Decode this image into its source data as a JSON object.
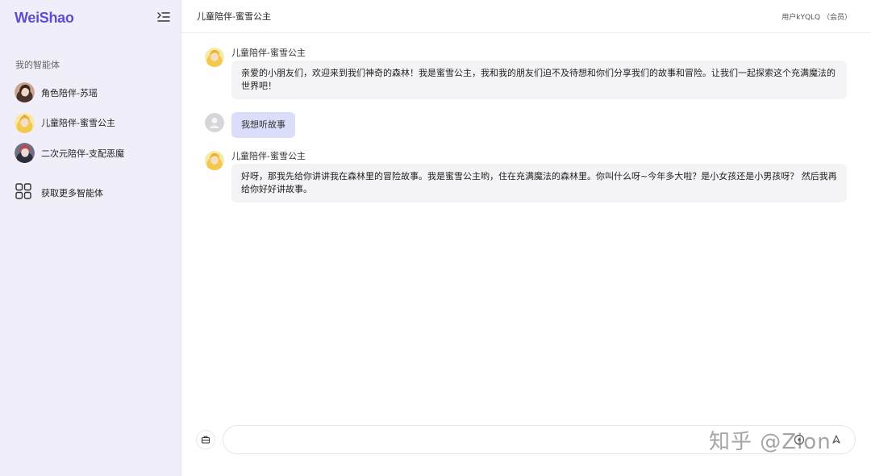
{
  "sidebar": {
    "logo": "WeiShao",
    "section_title": "我的智能体",
    "agents": [
      {
        "label": "角色陪伴-苏瑶",
        "avatar": "woman-portrait"
      },
      {
        "label": "儿童陪伴-蜜雪公主",
        "avatar": "princess-portrait"
      },
      {
        "label": "二次元陪伴-支配恶魔",
        "avatar": "anime-portrait"
      }
    ],
    "more_label": "获取更多智能体"
  },
  "header": {
    "title": "儿童陪伴-蜜雪公主",
    "user": "用户kYQLQ （会员）"
  },
  "messages": [
    {
      "role": "assistant",
      "sender": "儿童陪伴-蜜雪公主",
      "text": "亲爱的小朋友们，欢迎来到我们神奇的森林！我是蜜雪公主，我和我的朋友们迫不及待想和你们分享我们的故事和冒险。让我们一起探索这个充满魔法的世界吧！"
    },
    {
      "role": "user",
      "text": "我想听故事"
    },
    {
      "role": "assistant",
      "sender": "儿童陪伴-蜜雪公主",
      "text": "好呀，那我先给你讲讲我在森林里的冒险故事。我是蜜雪公主哟，住在充满魔法的森林里。你叫什么呀~今年多大啦？是小女孩还是小男孩呀？ 然后我再给你好好讲故事。"
    }
  ],
  "input": {
    "value": "",
    "placeholder": ""
  },
  "watermark": "知乎 @Zion",
  "colors": {
    "accent": "#5b4fcf",
    "sidebar_bg": "#f0eff9",
    "user_bubble": "#dcdcfb",
    "assistant_bubble": "#f4f4f6"
  }
}
